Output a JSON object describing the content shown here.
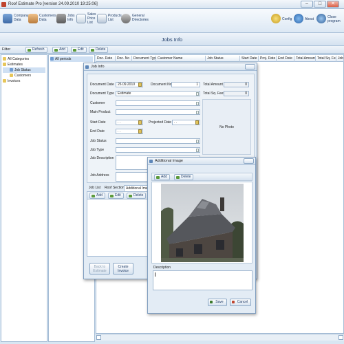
{
  "app": {
    "title": "Roof Estimate Pro [version 24.09.2010 19:25:06]",
    "window_buttons": {
      "minimize": "–",
      "maximize": "□",
      "close": "✕"
    }
  },
  "toolbar": {
    "company": "Company\nData",
    "customers": "Customers\nData",
    "jobs": "Jobs\nInfo",
    "sales": "Sales\nPrice\nList",
    "products": "Products\nList",
    "general": "General\nDirectories",
    "config": "Config",
    "about": "About",
    "close": "Close\nprogram"
  },
  "banner": {
    "title": "Jobs Info"
  },
  "filterbar": {
    "filter": "Filter",
    "refresh": "Refresh",
    "add": "Add",
    "edit": "Edit",
    "delete": "Delete"
  },
  "tree": {
    "all": "All Categories",
    "estimates": "Estimates",
    "job_status": "Job Status",
    "customers": "Customers",
    "invoices": "Invoices",
    "all_periods": "All periods"
  },
  "grid": {
    "columns": [
      "Doc. Date",
      "Doc. No",
      "Document Type",
      "Customer Name",
      "Job Status",
      "Start Date",
      "Proj. Date",
      "End Date",
      "Total Amount",
      "Total Sq. Feet",
      "Job Ad"
    ]
  },
  "job_info": {
    "title": "Job Info",
    "doc_date_label": "Document Date",
    "doc_date": "26.09.2010",
    "doc_no_label": "Document No",
    "doc_no": "1",
    "total_amount_label": "Total Amount",
    "total_amount": "0",
    "doc_type_label": "Document Type",
    "doc_type": "Estimate",
    "total_sq_label": "Total Sq. Feet",
    "total_sq": "0",
    "customer_label": "Customer",
    "main_product_label": "Main Product",
    "start_date_label": "Start Date",
    "start_date": ". .",
    "projected_date_label": "Projected Date",
    "projected_date": ". .",
    "end_date_label": "End Date",
    "end_date": ". .",
    "job_status_label": "Job Status",
    "job_type_label": "Job Type",
    "job_description_label": "Job Description",
    "job_address_label": "Job Address",
    "no_photo": "No Photo",
    "tabs": [
      "Job List",
      "Roof Sections",
      "Additional Image"
    ],
    "sub_add": "Add",
    "sub_edit": "Edit",
    "sub_delete": "Delete",
    "back_to_estimate": "Back to\nEstimate",
    "create_invoice": "Create\nInvoice"
  },
  "additional_image": {
    "title": "Additional Image",
    "add": "Add",
    "delete": "Delete",
    "description_label": "Description",
    "save": "Save",
    "cancel": "Cancel"
  },
  "colors": {
    "accent": "#1d3a66",
    "window_bg": "#d8e6f2",
    "dialog_bg": "#e3ecf5"
  }
}
